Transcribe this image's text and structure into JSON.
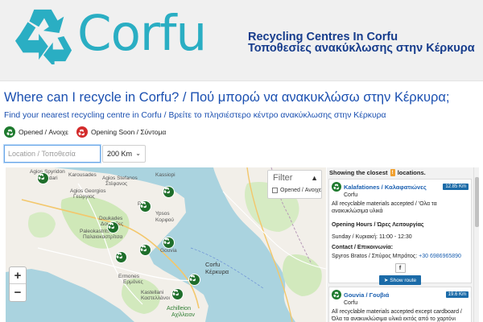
{
  "header": {
    "logo_text": "Corfu",
    "title_en": "Recycling Centres In Corfu",
    "title_gr": "Τοποθεσίες ανακύκλωσης στην Κέρκυρα",
    "brand_color": "#2aaec3",
    "title_color": "#163c8c"
  },
  "page": {
    "heading": "Where can I recycle in Corfu? / Πού μπορώ να ανακυκλώσω στην Κέρκυρα;",
    "subheading": "Find your nearest recycling centre in Corfu / Βρείτε το πλησιέστερο κέντρο ανακύκλωσης στην Κέρκυρα"
  },
  "legend": {
    "opened": "Opened / Ανοιχε",
    "opening_soon": "Opening Soon / Σύντομα",
    "opened_color": "#1e7a2e",
    "soon_color": "#d32b2b"
  },
  "search": {
    "placeholder": "Location / Τοποθεσία",
    "radius": "200 Km"
  },
  "map": {
    "filter_title": "Filter",
    "filter_option": "Opened / Ανοιχε",
    "zoom_in": "+",
    "zoom_out": "−",
    "labels": {
      "agios_spyridon": "Agios Spyridon",
      "sidari": "Sidari",
      "karousades": "Karousades",
      "agios_georgios": "Agios Georgios",
      "georgios": "Γεώργιος",
      "agios_stefanos": "Agios Stefanos",
      "stefanos": "Στέφανος",
      "kassiopi": "Kassiopi",
      "pyrgi": "Pyrgi",
      "ypsos": "Ypsos",
      "dukades": "Doukades",
      "doukades_gr": "Δουκάδες",
      "paleokastritsa": "Paleokastritsa",
      "paleokastritsa_gr": "Παλαιοκαστρίτσα",
      "korfou": "Κορφού",
      "gouvia": "Gouvia",
      "corfu": "Corfu",
      "corfu_gr": "Κέρκυρα",
      "ermones": "Ermones",
      "ermones_gr": "Ερμόνες",
      "kastellani": "Kastellani",
      "kastellani_gr": "Καστελλάνοι",
      "achilleion": "Achilleion",
      "achilleion_gr": "Αχίλλειον"
    }
  },
  "results": {
    "showing_prefix": "Showing the closest",
    "count": "!",
    "showing_suffix": "locations.",
    "cards": [
      {
        "name": "Kalafationes / Καλαφατιώνες",
        "city": "Corfu",
        "distance": "12.85 Km",
        "description": "All recyclable materials accepted / 'Ολα τα ανακυκλώσιμα υλικά",
        "hours_label": "Opening Hours / Ώρες Λειτουργίας",
        "hours": "Sunday / Κυριακή: 11:00 - 12:30",
        "contact_label": "Contact / Επικοινωνία:",
        "contact_name": "Spyros Bratos / Σπύρος Μπράτος:",
        "contact_phone": "+30 6986965890",
        "fb": "f",
        "route": "Show route"
      },
      {
        "name": "Gouvia / Γουβιά",
        "city": "Corfu",
        "distance": "19.6 Km",
        "description": "All recyclable materials accepted except cardboard / Όλα τα ανακυκλώσιμα υλικά εκτός από το χαρτόνι"
      }
    ]
  }
}
